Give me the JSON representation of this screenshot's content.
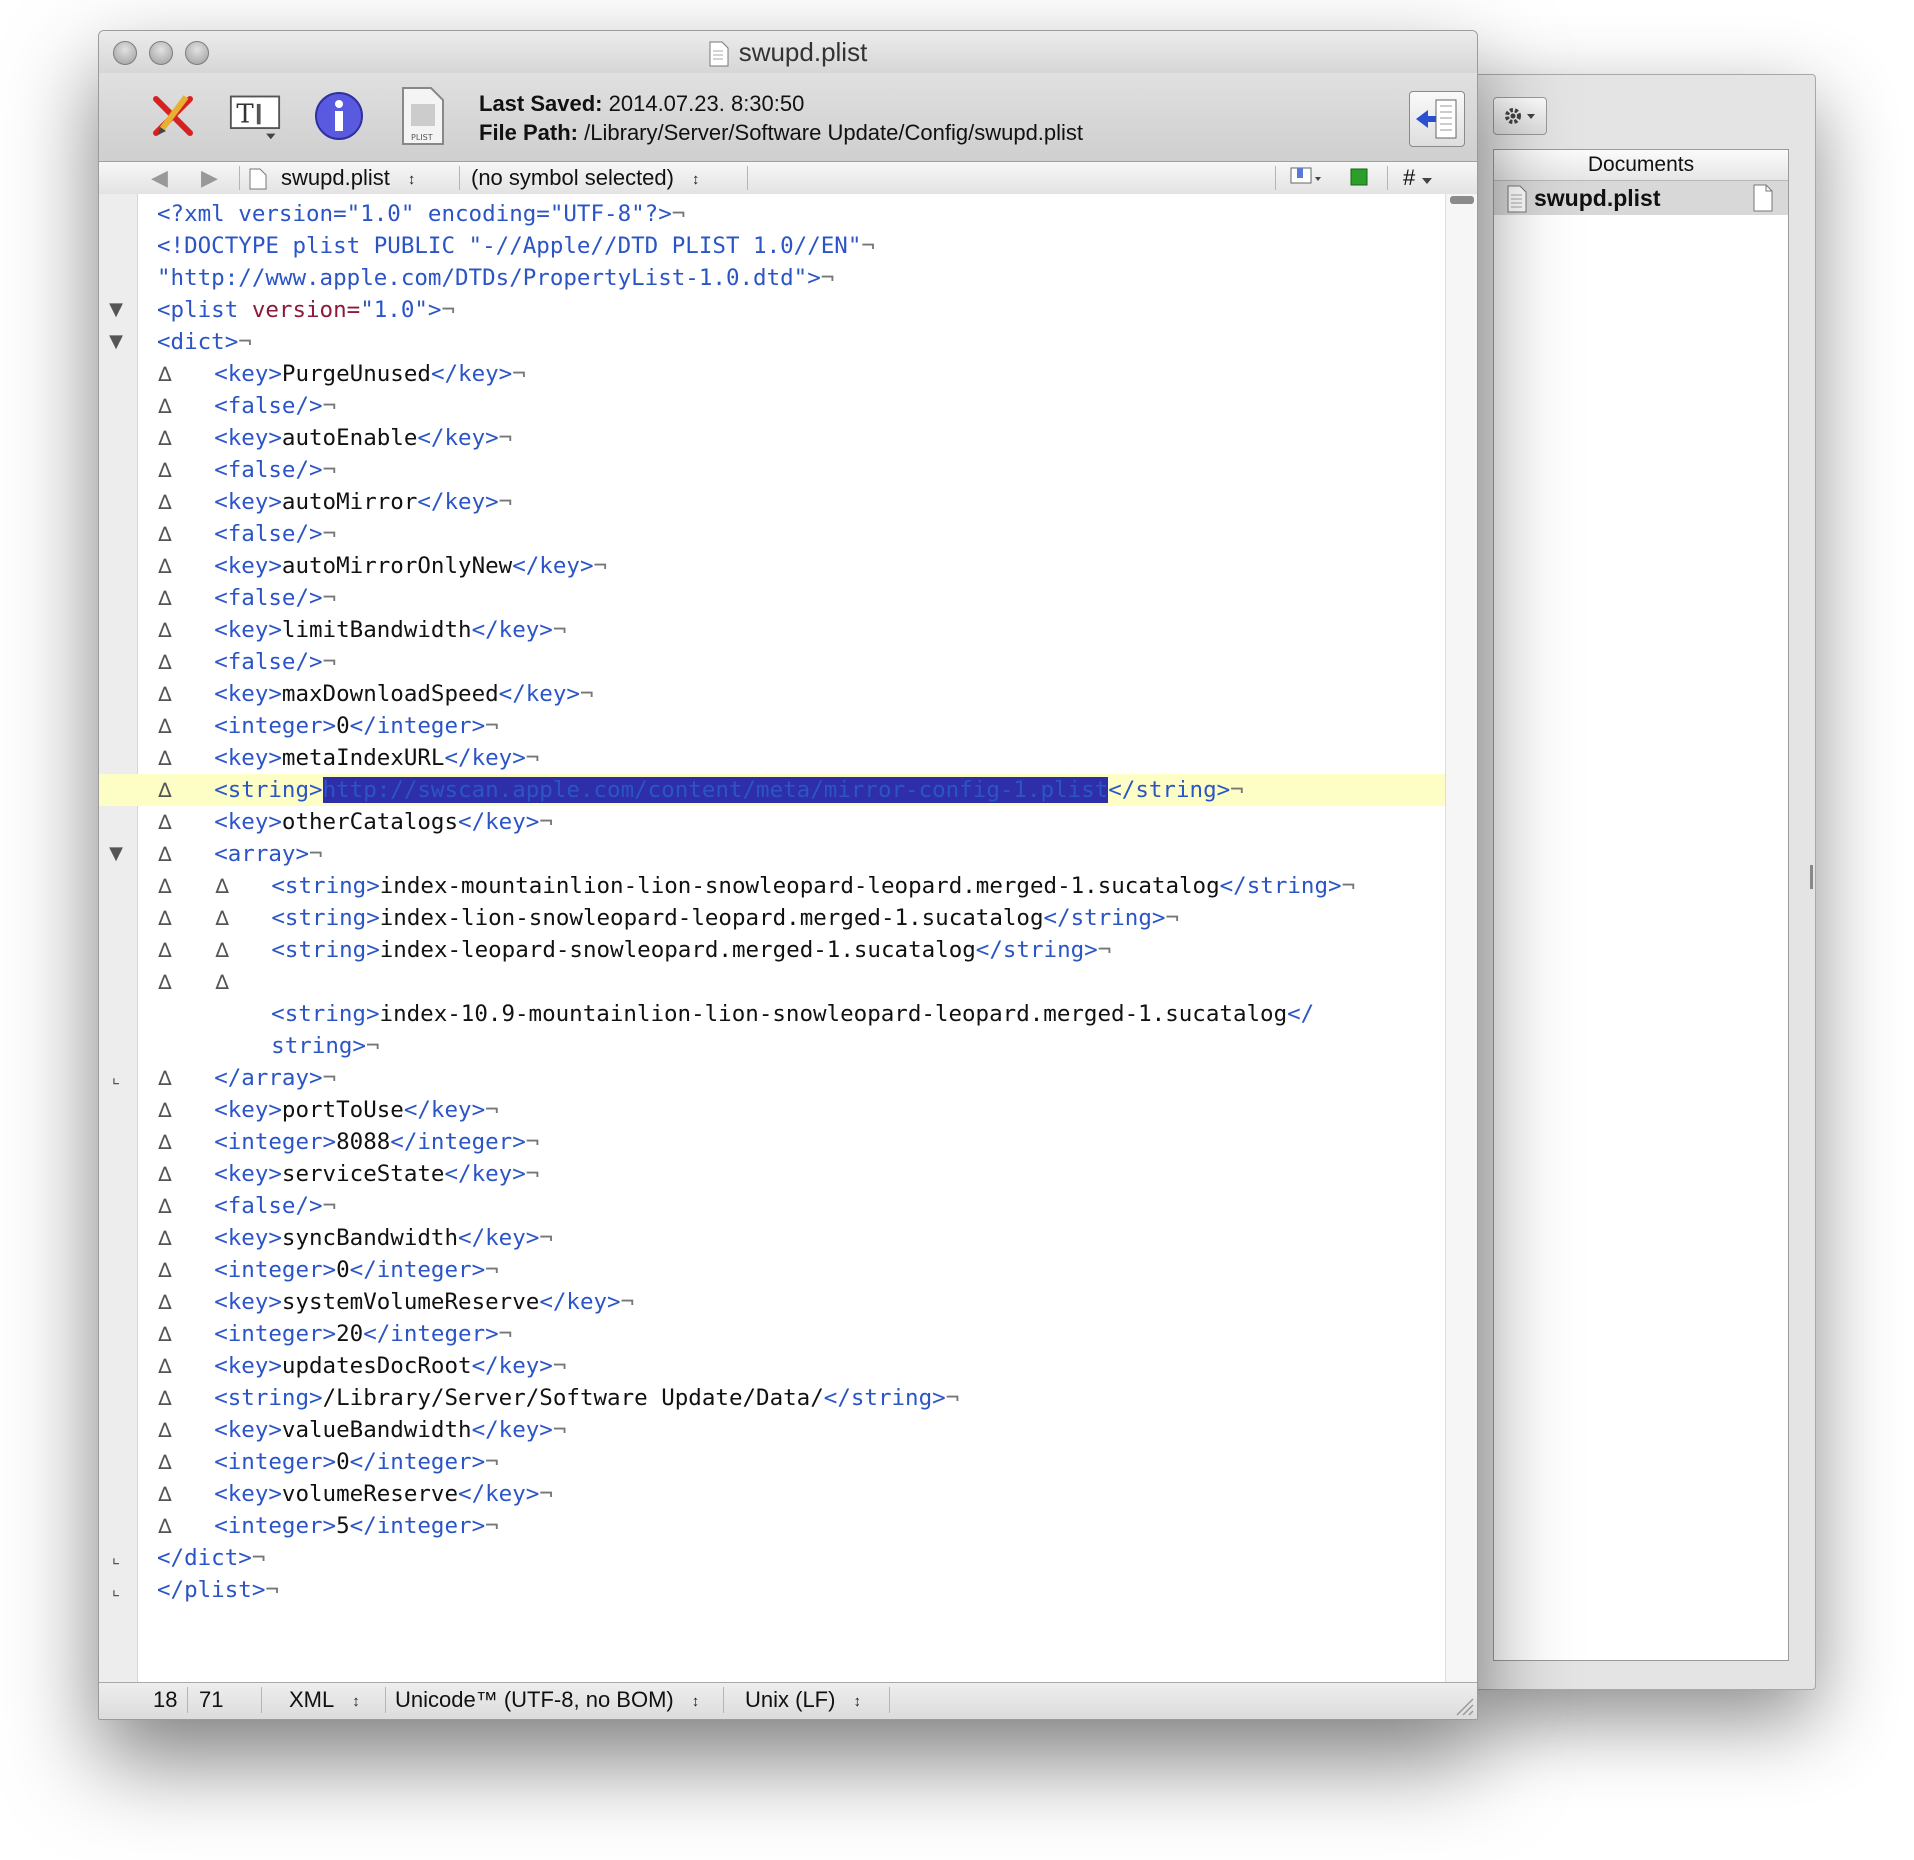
{
  "window": {
    "title": "swupd.plist",
    "last_saved_label": "Last Saved:",
    "last_saved_value": "2014.07.23. 8:30:50",
    "file_path_label": "File Path:",
    "file_path_value": "/Library/Server/Software Update/Config/swupd.plist"
  },
  "toolbar_icons": [
    "pencil-icon",
    "text-format-icon",
    "info-icon",
    "plist-file-icon",
    "drawer-toggle-icon"
  ],
  "navbar": {
    "file": "swupd.plist",
    "symbol": "(no symbol selected)",
    "hash": "#"
  },
  "drawer": {
    "header": "Documents",
    "document": "swupd.plist"
  },
  "statusbar": {
    "line": "18",
    "column": "71",
    "syntax": "XML",
    "encoding": "Unicode™ (UTF-8, no BOM)",
    "line_endings": "Unix (LF)"
  },
  "code_lines": [
    {
      "fold": "",
      "tabs": 0,
      "segs": [
        [
          "t",
          "<?xml version=\"1.0\" encoding=\"UTF-8\"?>"
        ]
      ]
    },
    {
      "fold": "",
      "tabs": 0,
      "segs": [
        [
          "t",
          "<!DOCTYPE plist PUBLIC \"-//Apple//DTD PLIST 1.0//EN\""
        ]
      ]
    },
    {
      "fold": "",
      "tabs": 0,
      "segs": [
        [
          "t",
          "\"http://www.apple.com/DTDs/PropertyList-1.0.dtd\">"
        ]
      ]
    },
    {
      "fold": "▼",
      "tabs": 0,
      "segs": [
        [
          "t",
          "<plist "
        ],
        [
          "a",
          "version="
        ],
        [
          "t",
          "\"1.0\">"
        ]
      ]
    },
    {
      "fold": "▼",
      "tabs": 0,
      "segs": [
        [
          "t",
          "<dict>"
        ]
      ]
    },
    {
      "fold": "",
      "tabs": 1,
      "segs": [
        [
          "t",
          "<key>"
        ],
        [
          "x",
          "PurgeUnused"
        ],
        [
          "t",
          "</key>"
        ]
      ]
    },
    {
      "fold": "",
      "tabs": 1,
      "segs": [
        [
          "t",
          "<false/>"
        ]
      ]
    },
    {
      "fold": "",
      "tabs": 1,
      "segs": [
        [
          "t",
          "<key>"
        ],
        [
          "x",
          "autoEnable"
        ],
        [
          "t",
          "</key>"
        ]
      ]
    },
    {
      "fold": "",
      "tabs": 1,
      "segs": [
        [
          "t",
          "<false/>"
        ]
      ]
    },
    {
      "fold": "",
      "tabs": 1,
      "segs": [
        [
          "t",
          "<key>"
        ],
        [
          "x",
          "autoMirror"
        ],
        [
          "t",
          "</key>"
        ]
      ]
    },
    {
      "fold": "",
      "tabs": 1,
      "segs": [
        [
          "t",
          "<false/>"
        ]
      ]
    },
    {
      "fold": "",
      "tabs": 1,
      "segs": [
        [
          "t",
          "<key>"
        ],
        [
          "x",
          "autoMirrorOnlyNew"
        ],
        [
          "t",
          "</key>"
        ]
      ]
    },
    {
      "fold": "",
      "tabs": 1,
      "segs": [
        [
          "t",
          "<false/>"
        ]
      ]
    },
    {
      "fold": "",
      "tabs": 1,
      "segs": [
        [
          "t",
          "<key>"
        ],
        [
          "x",
          "limitBandwidth"
        ],
        [
          "t",
          "</key>"
        ]
      ]
    },
    {
      "fold": "",
      "tabs": 1,
      "segs": [
        [
          "t",
          "<false/>"
        ]
      ]
    },
    {
      "fold": "",
      "tabs": 1,
      "segs": [
        [
          "t",
          "<key>"
        ],
        [
          "x",
          "maxDownloadSpeed"
        ],
        [
          "t",
          "</key>"
        ]
      ]
    },
    {
      "fold": "",
      "tabs": 1,
      "segs": [
        [
          "t",
          "<integer>"
        ],
        [
          "x",
          "0"
        ],
        [
          "t",
          "</integer>"
        ]
      ]
    },
    {
      "fold": "",
      "tabs": 1,
      "segs": [
        [
          "t",
          "<key>"
        ],
        [
          "x",
          "metaIndexURL"
        ],
        [
          "t",
          "</key>"
        ]
      ]
    },
    {
      "fold": "",
      "tabs": 1,
      "hl": true,
      "segs": [
        [
          "t",
          "<string>"
        ],
        [
          "sel",
          "http://swscan.apple.com/content/meta/mirror-config-1.plist"
        ],
        [
          "t",
          "</string>"
        ]
      ]
    },
    {
      "fold": "",
      "tabs": 1,
      "segs": [
        [
          "t",
          "<key>"
        ],
        [
          "x",
          "otherCatalogs"
        ],
        [
          "t",
          "</key>"
        ]
      ]
    },
    {
      "fold": "▼",
      "tabs": 1,
      "segs": [
        [
          "t",
          "<array>"
        ]
      ]
    },
    {
      "fold": "",
      "tabs": 2,
      "segs": [
        [
          "t",
          "<string>"
        ],
        [
          "x",
          "index-mountainlion-lion-snowleopard-leopard.merged-1.sucatalog"
        ],
        [
          "t",
          "</string>"
        ]
      ]
    },
    {
      "fold": "",
      "tabs": 2,
      "segs": [
        [
          "t",
          "<string>"
        ],
        [
          "x",
          "index-lion-snowleopard-leopard.merged-1.sucatalog"
        ],
        [
          "t",
          "</string>"
        ]
      ]
    },
    {
      "fold": "",
      "tabs": 2,
      "segs": [
        [
          "t",
          "<string>"
        ],
        [
          "x",
          "index-leopard-snowleopard.merged-1.sucatalog"
        ],
        [
          "t",
          "</string>"
        ]
      ]
    },
    {
      "fold": "",
      "tabs": 2,
      "noeol": true,
      "segs": []
    },
    {
      "fold": "",
      "tabs": 0,
      "indent": 8,
      "noeol": true,
      "segs": [
        [
          "t",
          "<string>"
        ],
        [
          "x",
          "index-10.9-mountainlion-lion-snowleopard-leopard.merged-1.sucatalog"
        ],
        [
          "t",
          "</"
        ]
      ]
    },
    {
      "fold": "",
      "tabs": 0,
      "indent": 8,
      "segs": [
        [
          "t",
          "string>"
        ]
      ]
    },
    {
      "fold": "⌞",
      "tabs": 1,
      "segs": [
        [
          "t",
          "</array>"
        ]
      ]
    },
    {
      "fold": "",
      "tabs": 1,
      "segs": [
        [
          "t",
          "<key>"
        ],
        [
          "x",
          "portToUse"
        ],
        [
          "t",
          "</key>"
        ]
      ]
    },
    {
      "fold": "",
      "tabs": 1,
      "segs": [
        [
          "t",
          "<integer>"
        ],
        [
          "x",
          "8088"
        ],
        [
          "t",
          "</integer>"
        ]
      ]
    },
    {
      "fold": "",
      "tabs": 1,
      "segs": [
        [
          "t",
          "<key>"
        ],
        [
          "x",
          "serviceState"
        ],
        [
          "t",
          "</key>"
        ]
      ]
    },
    {
      "fold": "",
      "tabs": 1,
      "segs": [
        [
          "t",
          "<false/>"
        ]
      ]
    },
    {
      "fold": "",
      "tabs": 1,
      "segs": [
        [
          "t",
          "<key>"
        ],
        [
          "x",
          "syncBandwidth"
        ],
        [
          "t",
          "</key>"
        ]
      ]
    },
    {
      "fold": "",
      "tabs": 1,
      "segs": [
        [
          "t",
          "<integer>"
        ],
        [
          "x",
          "0"
        ],
        [
          "t",
          "</integer>"
        ]
      ]
    },
    {
      "fold": "",
      "tabs": 1,
      "segs": [
        [
          "t",
          "<key>"
        ],
        [
          "x",
          "systemVolumeReserve"
        ],
        [
          "t",
          "</key>"
        ]
      ]
    },
    {
      "fold": "",
      "tabs": 1,
      "segs": [
        [
          "t",
          "<integer>"
        ],
        [
          "x",
          "20"
        ],
        [
          "t",
          "</integer>"
        ]
      ]
    },
    {
      "fold": "",
      "tabs": 1,
      "segs": [
        [
          "t",
          "<key>"
        ],
        [
          "x",
          "updatesDocRoot"
        ],
        [
          "t",
          "</key>"
        ]
      ]
    },
    {
      "fold": "",
      "tabs": 1,
      "segs": [
        [
          "t",
          "<string>"
        ],
        [
          "x",
          "/Library/Server/Software Update/Data/"
        ],
        [
          "t",
          "</string>"
        ]
      ]
    },
    {
      "fold": "",
      "tabs": 1,
      "segs": [
        [
          "t",
          "<key>"
        ],
        [
          "x",
          "valueBandwidth"
        ],
        [
          "t",
          "</key>"
        ]
      ]
    },
    {
      "fold": "",
      "tabs": 1,
      "segs": [
        [
          "t",
          "<integer>"
        ],
        [
          "x",
          "0"
        ],
        [
          "t",
          "</integer>"
        ]
      ]
    },
    {
      "fold": "",
      "tabs": 1,
      "segs": [
        [
          "t",
          "<key>"
        ],
        [
          "x",
          "volumeReserve"
        ],
        [
          "t",
          "</key>"
        ]
      ]
    },
    {
      "fold": "",
      "tabs": 1,
      "segs": [
        [
          "t",
          "<integer>"
        ],
        [
          "x",
          "5"
        ],
        [
          "t",
          "</integer>"
        ]
      ]
    },
    {
      "fold": "⌞",
      "tabs": 0,
      "segs": [
        [
          "t",
          "</dict>"
        ]
      ]
    },
    {
      "fold": "⌞",
      "tabs": 0,
      "segs": [
        [
          "t",
          "</plist>"
        ]
      ]
    }
  ],
  "symbols": {
    "tab_marker": "∆",
    "eol_marker": "¬",
    "up_down": "↕"
  }
}
